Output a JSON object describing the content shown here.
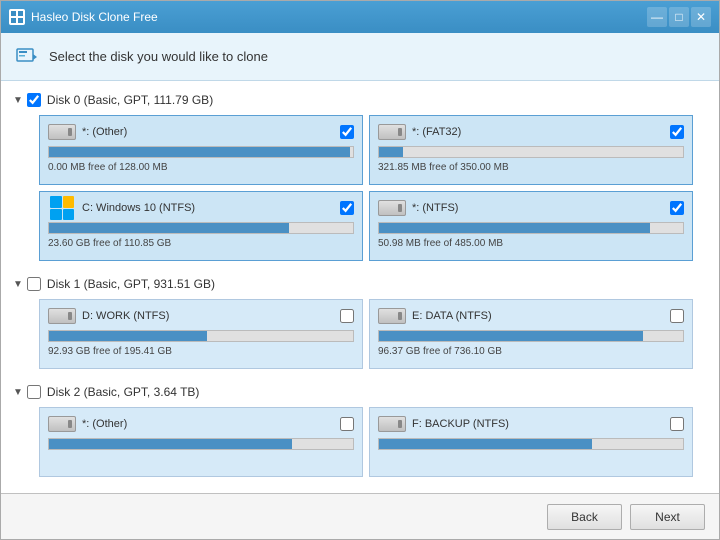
{
  "window": {
    "title": "Hasleo Disk Clone Free",
    "titlebar_icon": "H",
    "controls": {
      "minimize": "—",
      "maximize": "□",
      "close": "✕"
    }
  },
  "header": {
    "icon": "→",
    "text": "Select the disk you would like to clone"
  },
  "disks": [
    {
      "id": "disk0",
      "label": "Disk 0 (Basic, GPT, 111.79 GB)",
      "expanded": true,
      "checked": true,
      "partitions": [
        {
          "id": "p0_0",
          "name": "*: (Other)",
          "checked": true,
          "icon_type": "drive",
          "free_text": "0.00 MB free of 128.00 MB",
          "fill_pct": 99
        },
        {
          "id": "p0_1",
          "name": "*: (FAT32)",
          "checked": true,
          "icon_type": "drive",
          "free_text": "321.85 MB free of 350.00 MB",
          "fill_pct": 8
        },
        {
          "id": "p0_2",
          "name": "C: Windows 10 (NTFS)",
          "checked": true,
          "icon_type": "windows",
          "free_text": "23.60 GB free of 110.85 GB",
          "fill_pct": 79
        },
        {
          "id": "p0_3",
          "name": "*: (NTFS)",
          "checked": true,
          "icon_type": "drive",
          "free_text": "50.98 MB free of 485.00 MB",
          "fill_pct": 89
        }
      ]
    },
    {
      "id": "disk1",
      "label": "Disk 1 (Basic, GPT, 931.51 GB)",
      "expanded": true,
      "checked": false,
      "partitions": [
        {
          "id": "p1_0",
          "name": "D: WORK (NTFS)",
          "checked": false,
          "icon_type": "drive",
          "free_text": "92.93 GB free of 195.41 GB",
          "fill_pct": 52
        },
        {
          "id": "p1_1",
          "name": "E: DATA (NTFS)",
          "checked": false,
          "icon_type": "drive",
          "free_text": "96.37 GB free of 736.10 GB",
          "fill_pct": 87
        }
      ]
    },
    {
      "id": "disk2",
      "label": "Disk 2 (Basic, GPT, 3.64 TB)",
      "expanded": true,
      "checked": false,
      "partitions": [
        {
          "id": "p2_0",
          "name": "*: (Other)",
          "checked": false,
          "icon_type": "drive",
          "free_text": "",
          "fill_pct": 80
        },
        {
          "id": "p2_1",
          "name": "F: BACKUP (NTFS)",
          "checked": false,
          "icon_type": "drive",
          "free_text": "",
          "fill_pct": 70
        }
      ]
    }
  ],
  "footer": {
    "back_label": "Back",
    "next_label": "Next"
  }
}
